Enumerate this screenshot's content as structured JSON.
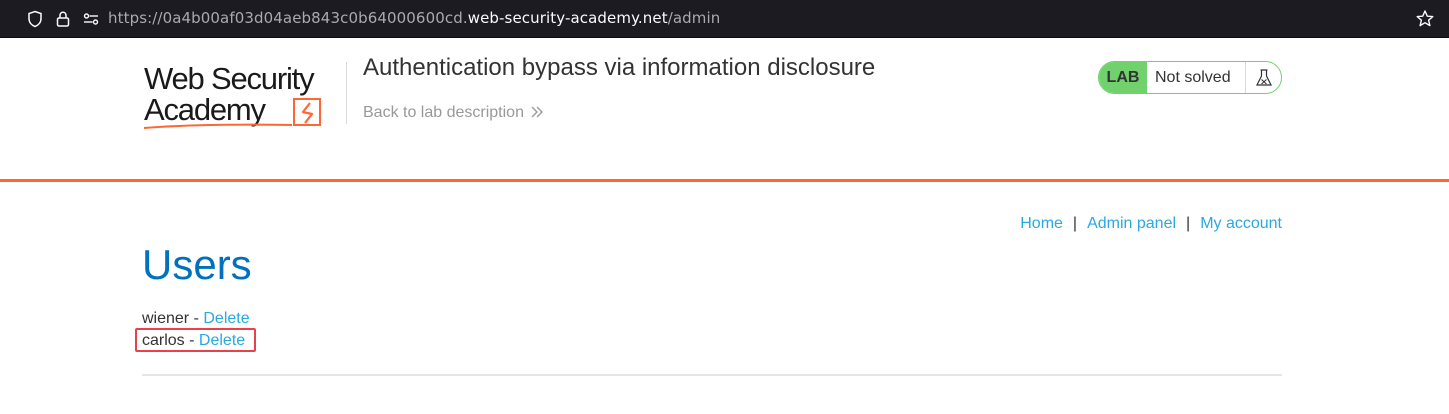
{
  "browser": {
    "url_prefix": "https://0a4b00af03d04aeb843c0b64000600cd.",
    "url_domain": "web-security-academy.net",
    "url_path": "/admin"
  },
  "header": {
    "logo_line1": "Web Security",
    "logo_line2": "Academy",
    "lab_title": "Authentication bypass via information disclosure",
    "back_link": "Back to lab description",
    "status_tag": "LAB",
    "status_text": "Not solved"
  },
  "nav": {
    "items": [
      "Home",
      "Admin panel",
      "My account"
    ],
    "separator": "|"
  },
  "main": {
    "title": "Users",
    "users": [
      {
        "name": "wiener",
        "dash": " - ",
        "action": "Delete"
      },
      {
        "name": "carlos",
        "dash": " - ",
        "action": "Delete"
      }
    ]
  },
  "colors": {
    "accent_orange": "#ff6633",
    "link_blue": "#29a9e0",
    "title_blue": "#0071bc",
    "lab_green": "#70d16d",
    "highlight_red": "#e8414b"
  }
}
